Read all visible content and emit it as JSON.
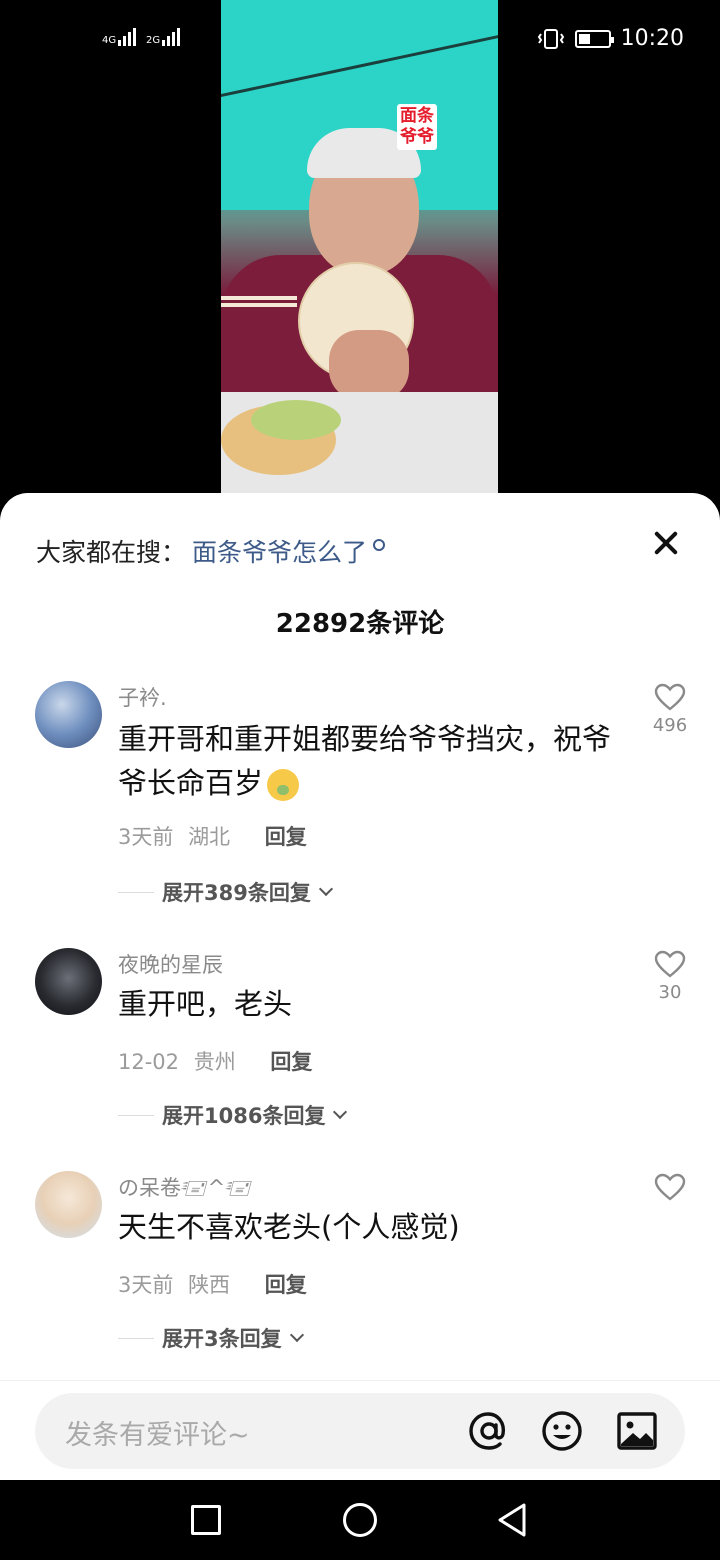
{
  "status_bar": {
    "sim1_label": "4G",
    "sim2_label": "2G",
    "time": "10:20",
    "battery_level": 0.35
  },
  "video": {
    "overlay_text": "面条爷爷"
  },
  "search": {
    "prefix": "大家都在搜：",
    "suggestion": "面条爷爷怎么了"
  },
  "comments_header": {
    "count_label": "22892条评论"
  },
  "comments": [
    {
      "username": "子衿.",
      "text": "重开哥和重开姐都要给爷爷挡灾，祝爷爷长命百岁",
      "time": "3天前",
      "location": "湖北",
      "reply_label": "回复",
      "expand_label": "展开389条回复",
      "likes": "496"
    },
    {
      "username": "夜晚的星辰",
      "text": "重开吧，老头",
      "time": "12-02",
      "location": "贵州",
      "reply_label": "回复",
      "expand_label": "展开1086条回复",
      "likes": "30"
    },
    {
      "username": "の呆卷🖅^🖅",
      "text": "天生不喜欢老头(个人感觉)",
      "time": "3天前",
      "location": "陕西",
      "reply_label": "回复",
      "expand_label": "展开3条回复",
      "likes": ""
    }
  ],
  "input_bar": {
    "placeholder": "发条有爱评论~",
    "icons": [
      "at-icon",
      "emoji-icon",
      "image-icon"
    ]
  },
  "nav_bar": {
    "icons": [
      "recents-icon",
      "home-icon",
      "back-icon"
    ]
  }
}
